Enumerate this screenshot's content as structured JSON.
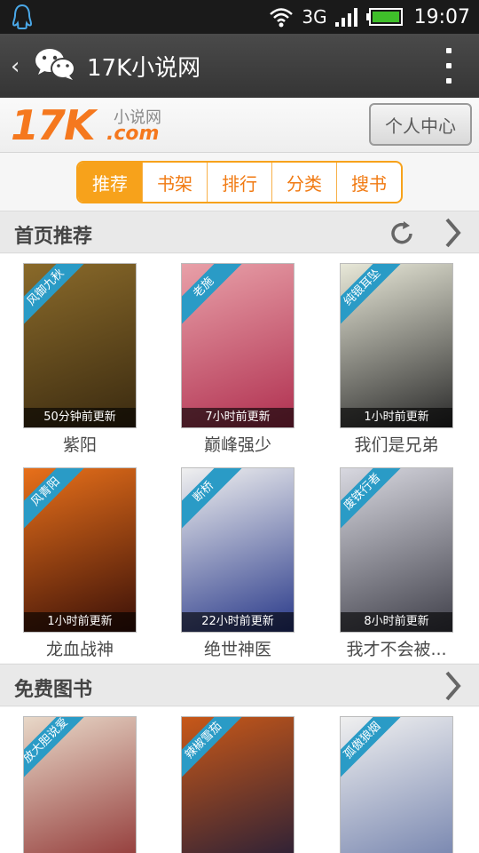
{
  "status_bar": {
    "network": "3G",
    "time": "19:07"
  },
  "title_bar": {
    "title": "17K小说网"
  },
  "brand": {
    "logo_text": "17K",
    "logo_sub": "小说网",
    "logo_domain": ".com",
    "user_center_label": "个人中心"
  },
  "tabs": [
    {
      "label": "推荐",
      "active": true
    },
    {
      "label": "书架",
      "active": false
    },
    {
      "label": "排行",
      "active": false
    },
    {
      "label": "分类",
      "active": false
    },
    {
      "label": "搜书",
      "active": false
    }
  ],
  "sections": [
    {
      "title": "首页推荐",
      "books": [
        {
          "title": "紫阳",
          "ribbon": "风御九秋",
          "update": "50分钟前更新",
          "colors": [
            "#8a6a2a",
            "#3a2a10"
          ]
        },
        {
          "title": "巅峰强少",
          "ribbon": "老施",
          "update": "7小时前更新",
          "colors": [
            "#e8a0a8",
            "#b03050"
          ]
        },
        {
          "title": "我们是兄弟",
          "ribbon": "纯银耳坠",
          "update": "1小时前更新",
          "colors": [
            "#e8e8d8",
            "#2a2a2a"
          ]
        },
        {
          "title": "龙血战神",
          "ribbon": "风青阳",
          "update": "1小时前更新",
          "colors": [
            "#e8701a",
            "#3a1008"
          ]
        },
        {
          "title": "绝世神医",
          "ribbon": "断桥",
          "update": "22小时前更新",
          "colors": [
            "#f0f0f0",
            "#2a3a8a"
          ]
        },
        {
          "title": "我才不会被...",
          "ribbon": "废铁行者",
          "update": "8小时前更新",
          "colors": [
            "#d8d8e0",
            "#40404a"
          ]
        }
      ]
    },
    {
      "title": "免费图书",
      "books": [
        {
          "title": "",
          "ribbon": "放大胆说爱",
          "update": "",
          "colors": [
            "#e8d8c8",
            "#8a2a2a"
          ]
        },
        {
          "title": "",
          "ribbon": "辣椒雪茄",
          "update": "",
          "colors": [
            "#c85818",
            "#1a1a3a"
          ]
        },
        {
          "title": "",
          "ribbon": "孤傲狼烟",
          "update": "",
          "colors": [
            "#f0f0f0",
            "#6a7aa8"
          ]
        }
      ]
    }
  ]
}
